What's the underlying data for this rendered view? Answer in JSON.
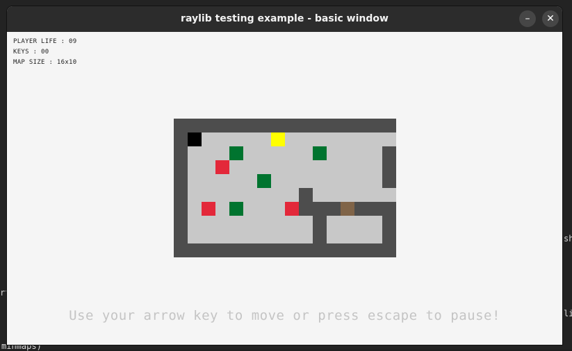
{
  "window": {
    "title": "raylib testing example - basic window"
  },
  "controls": {
    "minimize": "–",
    "close": "✕"
  },
  "hud": {
    "player_life": "PLAYER LIFE : 09",
    "keys": "KEYS : 00",
    "map_size": "MAP SIZE : 16x10"
  },
  "hint": "Use your arrow key to move or press escape to pause!",
  "terminal_fragments": [
    "rt",
    "sh",
    "li",
    "minmaps)"
  ],
  "colors": {
    "wall": "#4d4d4d",
    "floor": "#c8c8c8",
    "player": "#000000",
    "key": "#ffff00",
    "tree": "#00742f",
    "enemy": "#e3283a",
    "door": "#806448"
  },
  "map": {
    "cols": 16,
    "rows": 10,
    "legend": {
      "#": "wall",
      ".": "floor",
      "P": "player",
      "K": "key",
      "T": "tree",
      "E": "enemy",
      "D": "door"
    },
    "grid": [
      "################",
      "#P.....K........",
      "#...T.....T....#",
      "#..E...........#",
      "#.....T........#",
      "#........#......",
      "#.E.T...E###D###",
      "#.........#....#",
      "#.........#....#",
      "################"
    ]
  }
}
